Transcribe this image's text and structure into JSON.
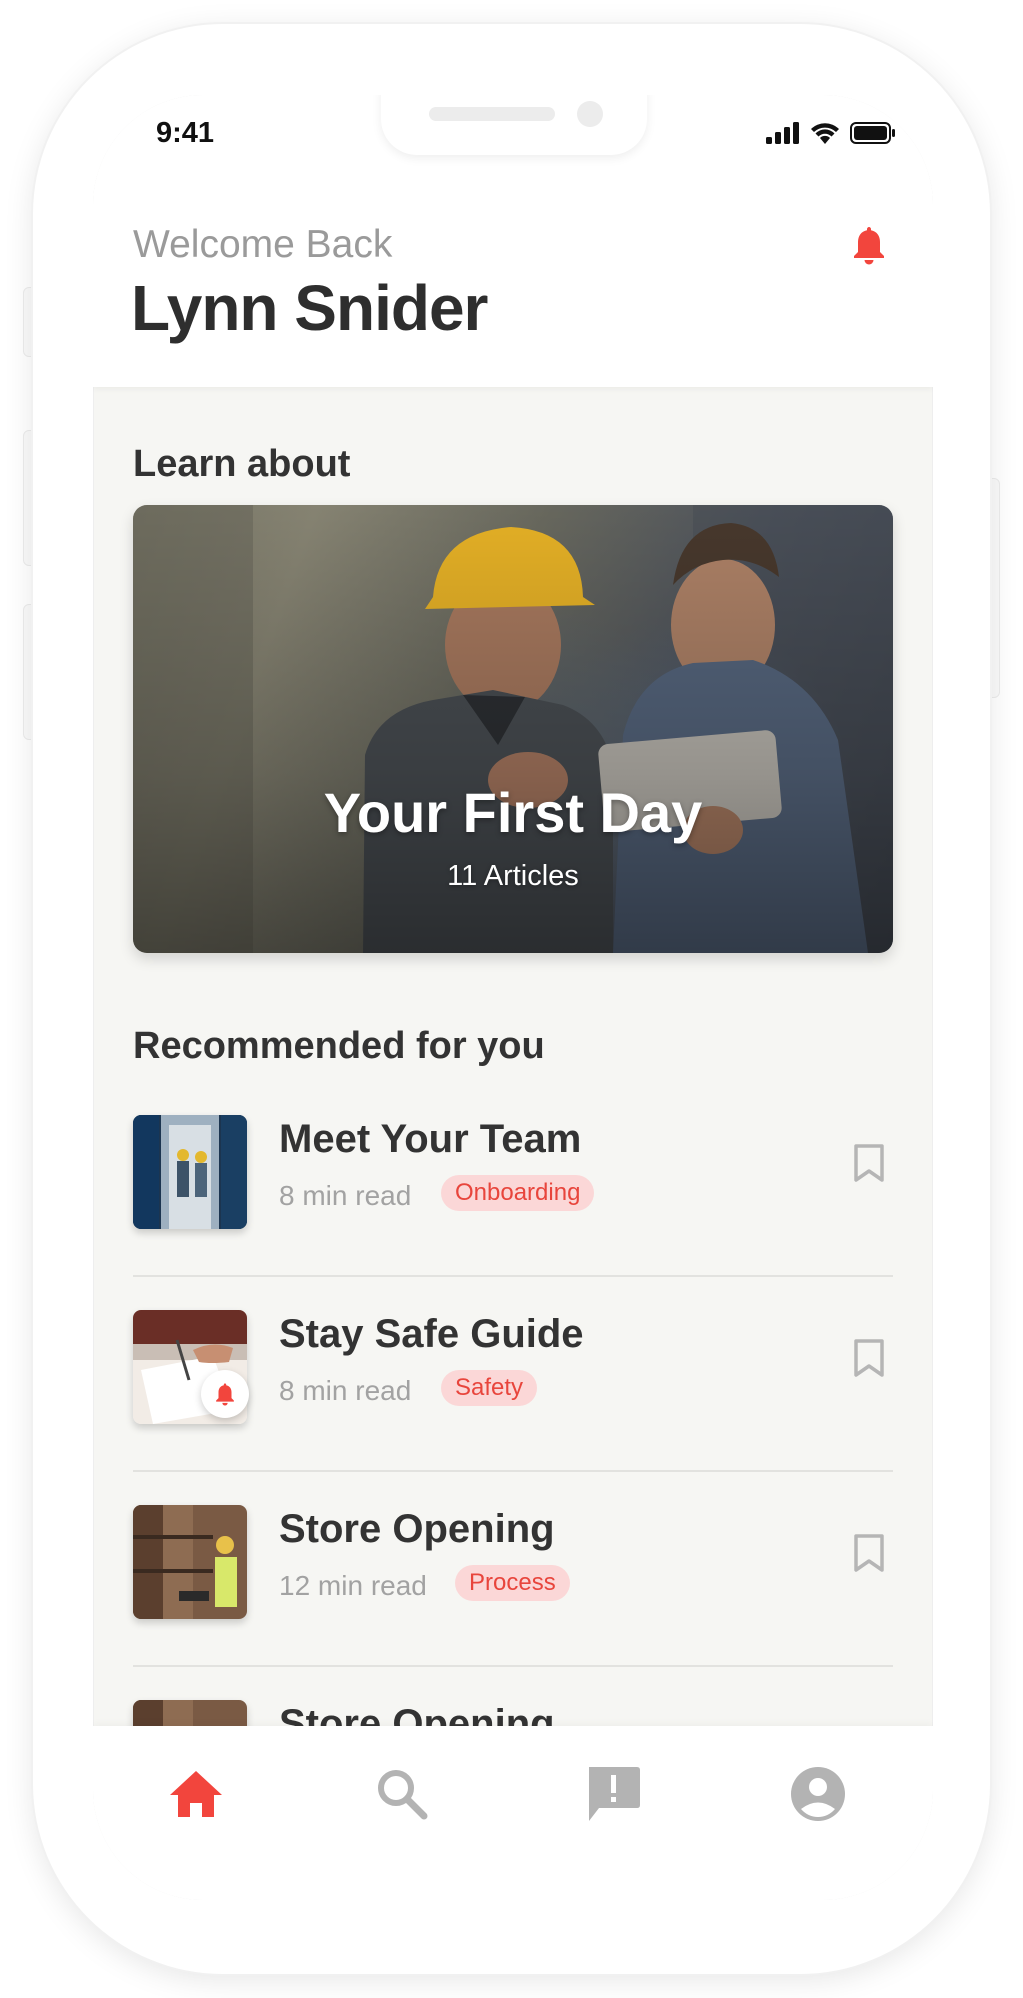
{
  "status_bar": {
    "time": "9:41"
  },
  "header": {
    "welcome": "Welcome Back",
    "user_name": "Lynn Snider"
  },
  "learn": {
    "section_title": "Learn about",
    "card": {
      "title": "Your First Day",
      "subtitle": "11 Articles"
    }
  },
  "recommended": {
    "section_title": "Recommended for you",
    "items": [
      {
        "title": "Meet Your Team",
        "read_time": "8 min read",
        "tag": "Onboarding",
        "thumb_icon": "workers-photo"
      },
      {
        "title": "Stay Safe Guide",
        "read_time": "8 min read",
        "tag": "Safety",
        "thumb_icon": "signing-photo",
        "has_alert": true
      },
      {
        "title": "Store Opening",
        "read_time": "12 min read",
        "tag": "Process",
        "thumb_icon": "warehouse-photo"
      },
      {
        "title": "Store Opening",
        "read_time": "",
        "tag": "",
        "thumb_icon": "warehouse-photo"
      }
    ]
  },
  "tabbar": {
    "tabs": [
      {
        "icon": "home-icon",
        "active": true
      },
      {
        "icon": "search-icon",
        "active": false
      },
      {
        "icon": "feedback-icon",
        "active": false
      },
      {
        "icon": "account-icon",
        "active": false
      }
    ]
  },
  "colors": {
    "accent": "#f2453d",
    "tag_bg": "#fbd7d7",
    "inactive_icon": "#b3b3b3",
    "background": "#f6f6f3"
  }
}
